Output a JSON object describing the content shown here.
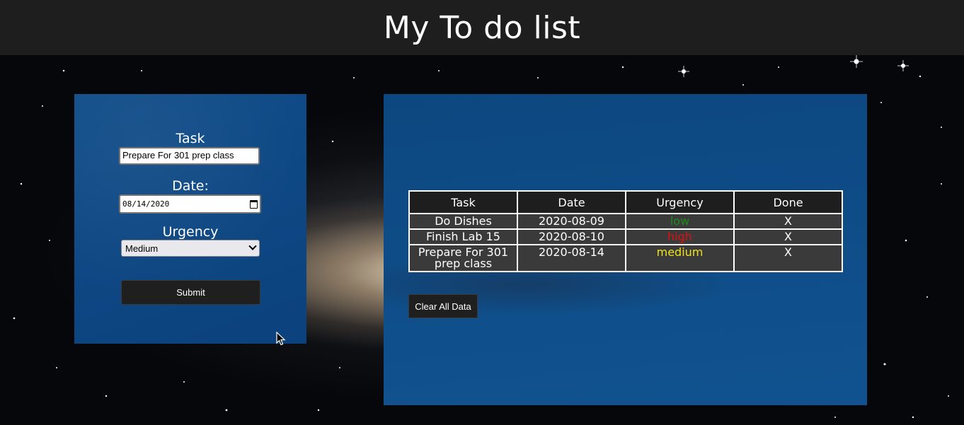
{
  "header": {
    "title": "My To do list"
  },
  "form": {
    "task_label": "Task",
    "task_value": "Prepare For 301 prep class",
    "date_label": "Date:",
    "date_value": "08/14/2020",
    "urgency_label": "Urgency",
    "urgency_selected": "Medium",
    "submit_label": "Submit"
  },
  "table": {
    "headers": [
      "Task",
      "Date",
      "Urgency",
      "Done"
    ],
    "rows": [
      {
        "task": "Do Dishes",
        "date": "2020-08-09",
        "urgency": "low",
        "urgency_color": "#1e8a1e",
        "done": "X"
      },
      {
        "task": "Finish Lab 15",
        "date": "2020-08-10",
        "urgency": "high",
        "urgency_color": "#e01010",
        "done": "X"
      },
      {
        "task": "Prepare For 301 prep class",
        "date": "2020-08-14",
        "urgency": "medium",
        "urgency_color": "#f0e020",
        "done": "X"
      }
    ]
  },
  "actions": {
    "clear_label": "Clear All Data"
  },
  "colors": {
    "header_bg": "#1e1e1e",
    "panel_bg": "#0e4e8c",
    "button_bg": "#1f1f1f"
  }
}
